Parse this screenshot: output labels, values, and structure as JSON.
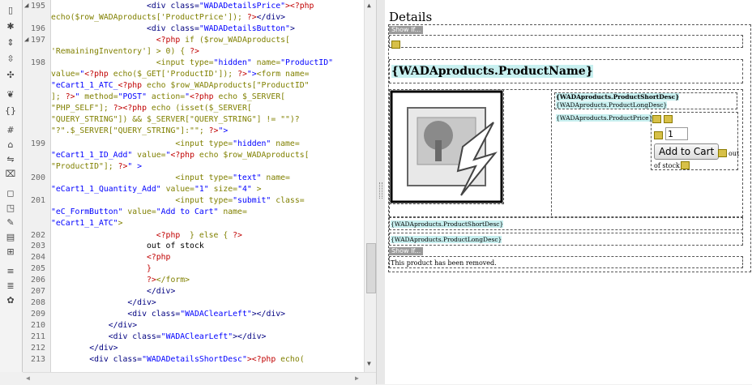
{
  "code_view": {
    "line_numbers": [
      "195",
      "196",
      "197",
      "198",
      "199",
      "200",
      "201",
      "202",
      "203",
      "204",
      "205",
      "206",
      "207",
      "208",
      "209",
      "210",
      "211",
      "212",
      "213"
    ],
    "lines": [
      [
        {
          "t": "                    ",
          "c": "tx"
        },
        {
          "t": "<div class=",
          "c": "tg"
        },
        {
          "t": "\"WADADetailsPrice\"",
          "c": "st"
        },
        {
          "t": "><?php",
          "c": "ph"
        }
      ],
      [
        {
          "t": "echo($row_WADAproducts['ProductPrice']); ",
          "c": "pv"
        },
        {
          "t": "?>",
          "c": "ph"
        },
        {
          "t": "</div>",
          "c": "tg"
        }
      ],
      [
        {
          "t": "                    ",
          "c": "tx"
        },
        {
          "t": "<div class=",
          "c": "tg"
        },
        {
          "t": "\"WADADetailsButton\"",
          "c": "st"
        },
        {
          "t": ">",
          "c": "tg"
        }
      ],
      [
        {
          "t": "                      ",
          "c": "tx"
        },
        {
          "t": "<?php",
          "c": "ph"
        },
        {
          "t": " if ($row_WADAproducts[",
          "c": "pv"
        }
      ],
      [
        {
          "t": "'RemainingInventory'] > 0) { ",
          "c": "pv"
        },
        {
          "t": "?>",
          "c": "ph"
        }
      ],
      [
        {
          "t": "                      ",
          "c": "tx"
        },
        {
          "t": "<input type=",
          "c": "pv"
        },
        {
          "t": "\"hidden\"",
          "c": "st"
        },
        {
          "t": " name=",
          "c": "pv"
        },
        {
          "t": "\"ProductID\"",
          "c": "st"
        }
      ],
      [
        {
          "t": "value=",
          "c": "pv"
        },
        {
          "t": "\"",
          "c": "st"
        },
        {
          "t": "<?php",
          "c": "ph"
        },
        {
          "t": " echo($_GET['ProductID']); ",
          "c": "pv"
        },
        {
          "t": "?>",
          "c": "ph"
        },
        {
          "t": "\">",
          "c": "st"
        },
        {
          "t": "<form name=",
          "c": "pv"
        }
      ],
      [
        {
          "t": "\"eCart1_1_ATC_",
          "c": "st"
        },
        {
          "t": "<?php",
          "c": "ph"
        },
        {
          "t": " echo $row_WADAproducts[\"ProductID\"",
          "c": "pv"
        }
      ],
      [
        {
          "t": "]; ",
          "c": "pv"
        },
        {
          "t": "?>",
          "c": "ph"
        },
        {
          "t": "\"",
          "c": "st"
        },
        {
          "t": " method=",
          "c": "pv"
        },
        {
          "t": "\"POST\"",
          "c": "st"
        },
        {
          "t": " action=",
          "c": "pv"
        },
        {
          "t": "\"",
          "c": "st"
        },
        {
          "t": "<?php",
          "c": "ph"
        },
        {
          "t": " echo $_SERVER[",
          "c": "pv"
        }
      ],
      [
        {
          "t": "\"PHP_SELF\"]; ",
          "c": "pv"
        },
        {
          "t": "?><?php",
          "c": "ph"
        },
        {
          "t": " echo (isset($_SERVER[",
          "c": "pv"
        }
      ],
      [
        {
          "t": "\"QUERY_STRING\"]) && $_SERVER[\"QUERY_STRING\"] != \"\")?",
          "c": "pv"
        }
      ],
      [
        {
          "t": "\"?\".$_SERVER[\"QUERY_STRING\"]:\"\"; ",
          "c": "pv"
        },
        {
          "t": "?>",
          "c": "ph"
        },
        {
          "t": "\">",
          "c": "st"
        }
      ],
      [
        {
          "t": "                          ",
          "c": "tx"
        },
        {
          "t": "<input type=",
          "c": "pv"
        },
        {
          "t": "\"hidden\"",
          "c": "st"
        },
        {
          "t": " name=",
          "c": "pv"
        }
      ],
      [
        {
          "t": "\"eCart1_1_ID_Add\"",
          "c": "st"
        },
        {
          "t": " value=",
          "c": "pv"
        },
        {
          "t": "\"",
          "c": "st"
        },
        {
          "t": "<?php",
          "c": "ph"
        },
        {
          "t": " echo $row_WADAproducts[",
          "c": "pv"
        }
      ],
      [
        {
          "t": "\"ProductID\"]; ",
          "c": "pv"
        },
        {
          "t": "?>",
          "c": "ph"
        },
        {
          "t": "\" >",
          "c": "st"
        }
      ],
      [
        {
          "t": "                          ",
          "c": "tx"
        },
        {
          "t": "<input type=",
          "c": "pv"
        },
        {
          "t": "\"text\"",
          "c": "st"
        },
        {
          "t": " name=",
          "c": "pv"
        }
      ],
      [
        {
          "t": "\"eCart1_1_Quantity_Add\"",
          "c": "st"
        },
        {
          "t": " value=",
          "c": "pv"
        },
        {
          "t": "\"1\"",
          "c": "st"
        },
        {
          "t": " size=",
          "c": "pv"
        },
        {
          "t": "\"4\"",
          "c": "st"
        },
        {
          "t": " >",
          "c": "pv"
        }
      ],
      [
        {
          "t": "                          ",
          "c": "tx"
        },
        {
          "t": "<input type=",
          "c": "pv"
        },
        {
          "t": "\"submit\"",
          "c": "st"
        },
        {
          "t": " class=",
          "c": "pv"
        }
      ],
      [
        {
          "t": "\"eC_FormButton\"",
          "c": "st"
        },
        {
          "t": " value=",
          "c": "pv"
        },
        {
          "t": "\"Add to Cart\"",
          "c": "st"
        },
        {
          "t": " name=",
          "c": "pv"
        }
      ],
      [
        {
          "t": "\"eCart1_1_ATC\"",
          "c": "st"
        },
        {
          "t": ">",
          "c": "pv"
        }
      ],
      [
        {
          "t": "                      ",
          "c": "tx"
        },
        {
          "t": "<?php",
          "c": "ph"
        },
        {
          "t": "  } else { ",
          "c": "pv"
        },
        {
          "t": "?>",
          "c": "ph"
        }
      ],
      [
        {
          "t": "                    out of stock",
          "c": "tx"
        }
      ],
      [
        {
          "t": "                    ",
          "c": "tx"
        },
        {
          "t": "<?php",
          "c": "ph"
        }
      ],
      [
        {
          "t": "                    }",
          "c": "ph"
        }
      ],
      [
        {
          "t": "                    ",
          "c": "tx"
        },
        {
          "t": "?>",
          "c": "ph"
        },
        {
          "t": "</form>",
          "c": "pv"
        }
      ],
      [
        {
          "t": "                    ",
          "c": "tx"
        },
        {
          "t": "</div>",
          "c": "tg"
        }
      ],
      [
        {
          "t": "                ",
          "c": "tx"
        },
        {
          "t": "</div>",
          "c": "tg"
        }
      ],
      [
        {
          "t": "                ",
          "c": "tx"
        },
        {
          "t": "<div class=",
          "c": "tg"
        },
        {
          "t": "\"WADAClearLeft\"",
          "c": "st"
        },
        {
          "t": "></div>",
          "c": "tg"
        }
      ],
      [
        {
          "t": "            ",
          "c": "tx"
        },
        {
          "t": "</div>",
          "c": "tg"
        }
      ],
      [
        {
          "t": "            ",
          "c": "tx"
        },
        {
          "t": "<div class=",
          "c": "tg"
        },
        {
          "t": "\"WADAClearLeft\"",
          "c": "st"
        },
        {
          "t": "></div>",
          "c": "tg"
        }
      ],
      [
        {
          "t": "        ",
          "c": "tx"
        },
        {
          "t": "</div>",
          "c": "tg"
        }
      ],
      [
        {
          "t": "        ",
          "c": "tx"
        },
        {
          "t": "<div class=",
          "c": "tg"
        },
        {
          "t": "\"WADADetailsShortDesc\"",
          "c": "st"
        },
        {
          "t": "><?php",
          "c": "ph"
        },
        {
          "t": " echo(",
          "c": "pv"
        }
      ]
    ]
  },
  "design_view": {
    "heading": "Details",
    "show_if_label": "Show If...",
    "product_name": "{WADAproducts.ProductName}",
    "short_desc_bind": "{WADAproducts.ProductShortDesc}",
    "long_desc_bind": "{WADAproducts.ProductLongDesc}",
    "price_bind": "{WADAproducts.ProductPrice}",
    "quantity_value": "1",
    "add_to_cart_label": "Add to Cart",
    "out_text": "out",
    "of_stock_text": "of stock",
    "removed_message": "This product has been removed."
  }
}
